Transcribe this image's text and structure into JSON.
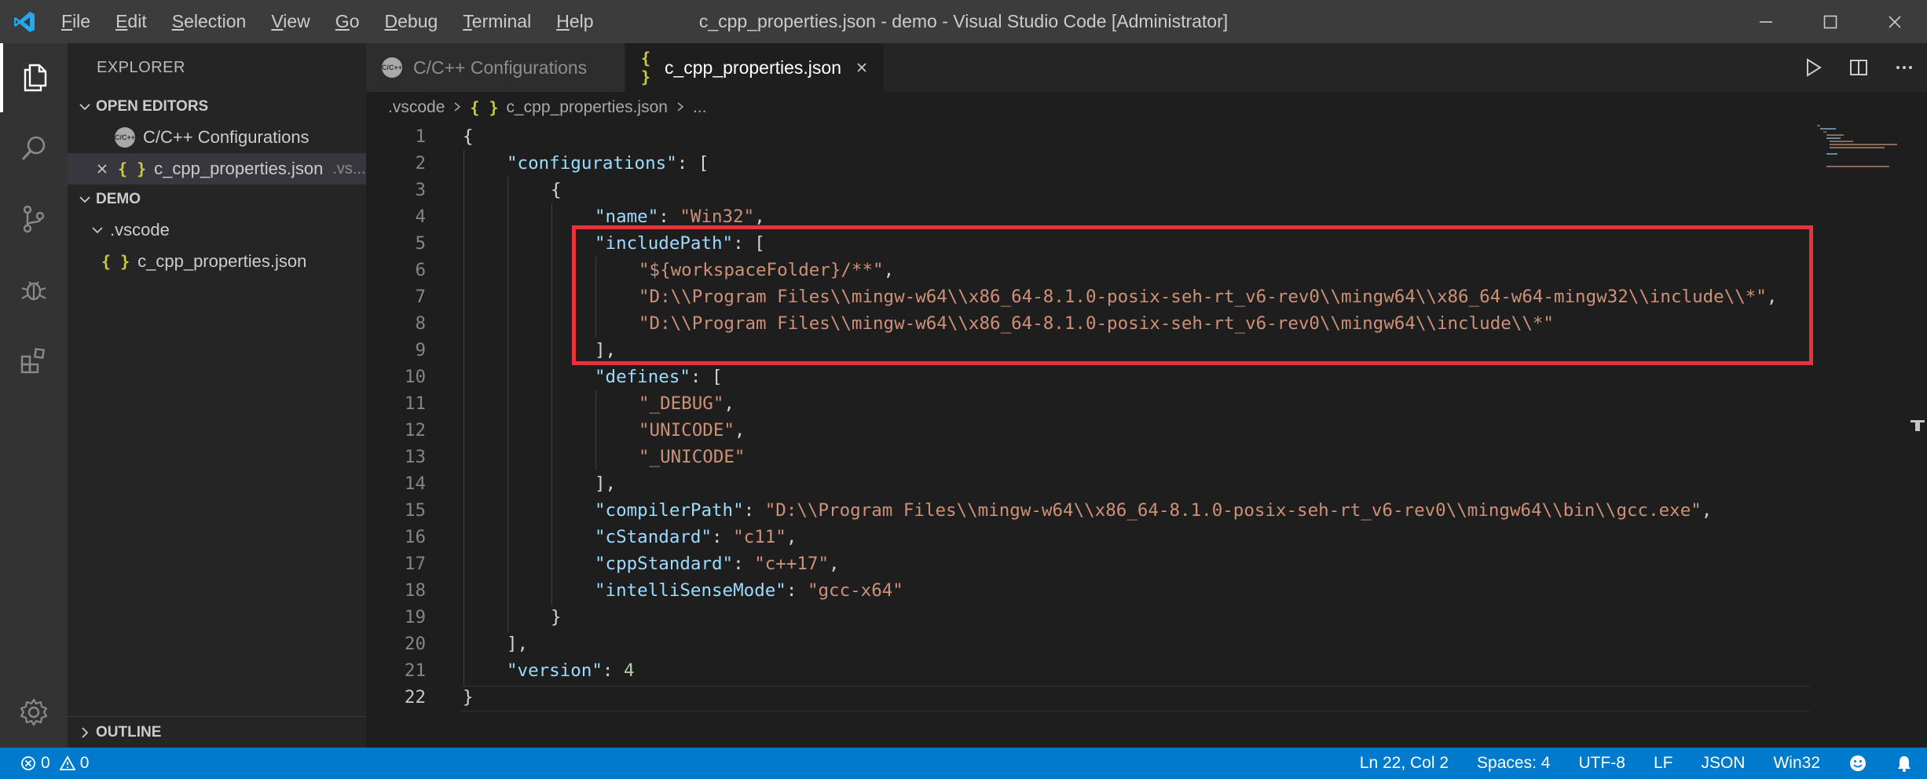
{
  "window": {
    "title": "c_cpp_properties.json - demo - Visual Studio Code [Administrator]",
    "menu": [
      "File",
      "Edit",
      "Selection",
      "View",
      "Go",
      "Debug",
      "Terminal",
      "Help"
    ]
  },
  "sidebar": {
    "title": "EXPLORER",
    "open_editors": {
      "header": "OPEN EDITORS",
      "items": [
        {
          "label": "C/C++ Configurations",
          "badge": "C/C++"
        },
        {
          "label": "c_cpp_properties.json",
          "hint": ".vs...",
          "badge": "{ }"
        }
      ]
    },
    "demo": {
      "header": "DEMO",
      "folder": ".vscode",
      "file": "c_cpp_properties.json",
      "badge": "{ }"
    },
    "outline": "OUTLINE"
  },
  "tabs": [
    {
      "label": "C/C++ Configurations",
      "badge": "C/C++",
      "active": false
    },
    {
      "label": "c_cpp_properties.json",
      "badge": "{ }",
      "active": true
    }
  ],
  "breadcrumb": {
    "folder": ".vscode",
    "file": "c_cpp_properties.json",
    "more": "...",
    "badge": "{ }"
  },
  "code": {
    "l1": {
      "num": "1",
      "t1": "{"
    },
    "l2": {
      "num": "2",
      "t1": "\"configurations\"",
      "t2": ": ["
    },
    "l3": {
      "num": "3",
      "t1": "{"
    },
    "l4": {
      "num": "4",
      "t1": "\"name\"",
      "t2": ": ",
      "t3": "\"Win32\"",
      "t4": ","
    },
    "l5": {
      "num": "5",
      "t1": "\"includePath\"",
      "t2": ": ["
    },
    "l6": {
      "num": "6",
      "t1": "\"${workspaceFolder}/**\"",
      "t2": ","
    },
    "l7": {
      "num": "7",
      "t1": "\"D:\\\\Program Files\\\\mingw-w64\\\\x86_64-8.1.0-posix-seh-rt_v6-rev0\\\\mingw64\\\\x86_64-w64-mingw32\\\\include\\\\*\"",
      "t2": ","
    },
    "l8": {
      "num": "8",
      "t1": "\"D:\\\\Program Files\\\\mingw-w64\\\\x86_64-8.1.0-posix-seh-rt_v6-rev0\\\\mingw64\\\\include\\\\*\""
    },
    "l9": {
      "num": "9",
      "t1": "],"
    },
    "l10": {
      "num": "10",
      "t1": "\"defines\"",
      "t2": ": ["
    },
    "l11": {
      "num": "11",
      "t1": "\"_DEBUG\"",
      "t2": ","
    },
    "l12": {
      "num": "12",
      "t1": "\"UNICODE\"",
      "t2": ","
    },
    "l13": {
      "num": "13",
      "t1": "\"_UNICODE\""
    },
    "l14": {
      "num": "14",
      "t1": "],"
    },
    "l15": {
      "num": "15",
      "t1": "\"compilerPath\"",
      "t2": ": ",
      "t3": "\"D:\\\\Program Files\\\\mingw-w64\\\\x86_64-8.1.0-posix-seh-rt_v6-rev0\\\\mingw64\\\\bin\\\\gcc.exe\"",
      "t4": ","
    },
    "l16": {
      "num": "16",
      "t1": "\"cStandard\"",
      "t2": ": ",
      "t3": "\"c11\"",
      "t4": ","
    },
    "l17": {
      "num": "17",
      "t1": "\"cppStandard\"",
      "t2": ": ",
      "t3": "\"c++17\"",
      "t4": ","
    },
    "l18": {
      "num": "18",
      "t1": "\"intelliSenseMode\"",
      "t2": ": ",
      "t3": "\"gcc-x64\""
    },
    "l19": {
      "num": "19",
      "t1": "}"
    },
    "l20": {
      "num": "20",
      "t1": "],"
    },
    "l21": {
      "num": "21",
      "t1": "\"version\"",
      "t2": ": ",
      "t3": "4"
    },
    "l22": {
      "num": "22",
      "t1": "}"
    }
  },
  "status": {
    "errors": "0",
    "warnings": "0",
    "position": "Ln 22, Col 2",
    "spaces": "Spaces: 4",
    "encoding": "UTF-8",
    "eol": "LF",
    "language": "JSON",
    "config": "Win32"
  },
  "colors": {
    "accent": "#007acc",
    "highlight_box": "#e8323c",
    "json_icon": "#cbcb41",
    "key": "#9cdcfe",
    "string": "#ce9178",
    "number": "#b5cea8"
  }
}
